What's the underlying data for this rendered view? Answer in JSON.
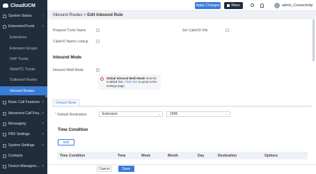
{
  "app": {
    "name": "CloudUCM"
  },
  "topbar": {
    "apply_label": "Apply Changes",
    "wave_label": "Wave",
    "username": "admin_Connectivity"
  },
  "sidebar": {
    "groups": [
      {
        "label": "System Status"
      },
      {
        "label": "Extension/Trunk"
      },
      {
        "label": "Basic Call Features"
      },
      {
        "label": "Advanced Call Fea..."
      },
      {
        "label": "Messaging"
      },
      {
        "label": "PBX Settings"
      },
      {
        "label": "System Settings"
      },
      {
        "label": "Contacts"
      },
      {
        "label": "Device Managem..."
      }
    ],
    "subitems": [
      {
        "label": "Extensions"
      },
      {
        "label": "Extension Groups"
      },
      {
        "label": "VoIP Trunks"
      },
      {
        "label": "WebRTC Trunks"
      },
      {
        "label": "Outbound Routes"
      },
      {
        "label": "Inbound Routes"
      }
    ]
  },
  "breadcrumb": {
    "parent": "Inbound Routes",
    "sep": ">",
    "current": "Edit Inbound Rule"
  },
  "form": {
    "prepend_label": "Prepend Trunk Name",
    "callerid_info_label": "Set CallerID Info",
    "callerid_lookup_label": "CallerID Name Lookup",
    "inbound_mode_title": "Inbound Mode",
    "multi_mode_label": "Inbound Multi Mode",
    "notice_bold": "Global Inbound Multi-Mode",
    "notice_text1": " must be enabled first.",
    "notice_link": "Click here",
    "notice_text2": " to jump to the settings page."
  },
  "tabs": {
    "default_mode": "Default Mode"
  },
  "destination": {
    "required_mark": "*",
    "label": "Default Destination",
    "type_value": "Extension",
    "ext_value": "1006"
  },
  "time_condition": {
    "title": "Time Condition",
    "add_label": "Add",
    "columns": [
      "Time Condition",
      "Time",
      "Week",
      "Month",
      "Day",
      "Destination",
      "Options"
    ]
  },
  "footer": {
    "cancel_label": "Cancel",
    "save_label": "Save"
  },
  "colors": {
    "accent": "#3a7bd5",
    "sidebar_bg": "#1f2d3d"
  }
}
